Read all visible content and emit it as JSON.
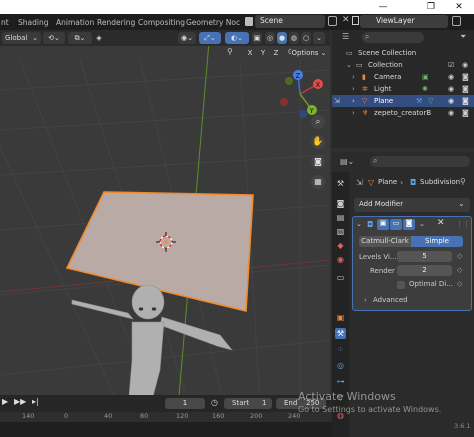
{
  "titlebar": {
    "minimize": "—",
    "maximize": "❐",
    "close": "✕"
  },
  "workspace_tabs": [
    "nt",
    "Shading",
    "Animation",
    "Rendering",
    "Compositing",
    "Geometry Noc"
  ],
  "scene": {
    "icon": "scene-icon",
    "name": "Scene"
  },
  "view_layer": {
    "icon": "view-layer-icon",
    "name": "ViewLayer"
  },
  "viewport_header": {
    "orientation": "Global",
    "axes": [
      "X",
      "Y",
      "Z"
    ],
    "options_label": "Options"
  },
  "gizmo": {
    "x": "X",
    "y": "Y",
    "z": "Z"
  },
  "outliner": {
    "root": "Scene Collection",
    "collection": "Collection",
    "items": [
      {
        "name": "Camera",
        "icon": "camera-icon"
      },
      {
        "name": "Light",
        "icon": "light-icon"
      },
      {
        "name": "Plane",
        "icon": "mesh-icon",
        "selected": true
      },
      {
        "name": "zepeto_creatorB",
        "icon": "armature-icon"
      }
    ]
  },
  "properties": {
    "breadcrumb_object": "Plane",
    "breadcrumb_modifier": "Subdivision",
    "add_modifier": "Add Modifier",
    "modifier_mode_options": [
      "Catmull-Clark",
      "Simple"
    ],
    "selected_mode": "Simple",
    "levels_viewport_label": "Levels Vi...",
    "levels_viewport_value": "5",
    "render_label": "Render",
    "render_value": "2",
    "optimal_display_label": "Optimal Di...",
    "advanced_label": "Advanced",
    "version": "3.6.1"
  },
  "timeline": {
    "current_frame": "1",
    "start_label": "Start",
    "start_value": "1",
    "end_label": "End",
    "end_value": "250",
    "ruler_ticks": [
      "140",
      "0",
      "40",
      "80",
      "120",
      "160",
      "200",
      "240"
    ]
  },
  "watermark": {
    "line1": "Activate Windows",
    "line2": "Go to Settings to activate Windows."
  },
  "colors": {
    "accent": "#4772b3",
    "plane_fill": "#b9aaa6",
    "plane_outline": "#f08a2a",
    "selected_row": "#334d80"
  }
}
